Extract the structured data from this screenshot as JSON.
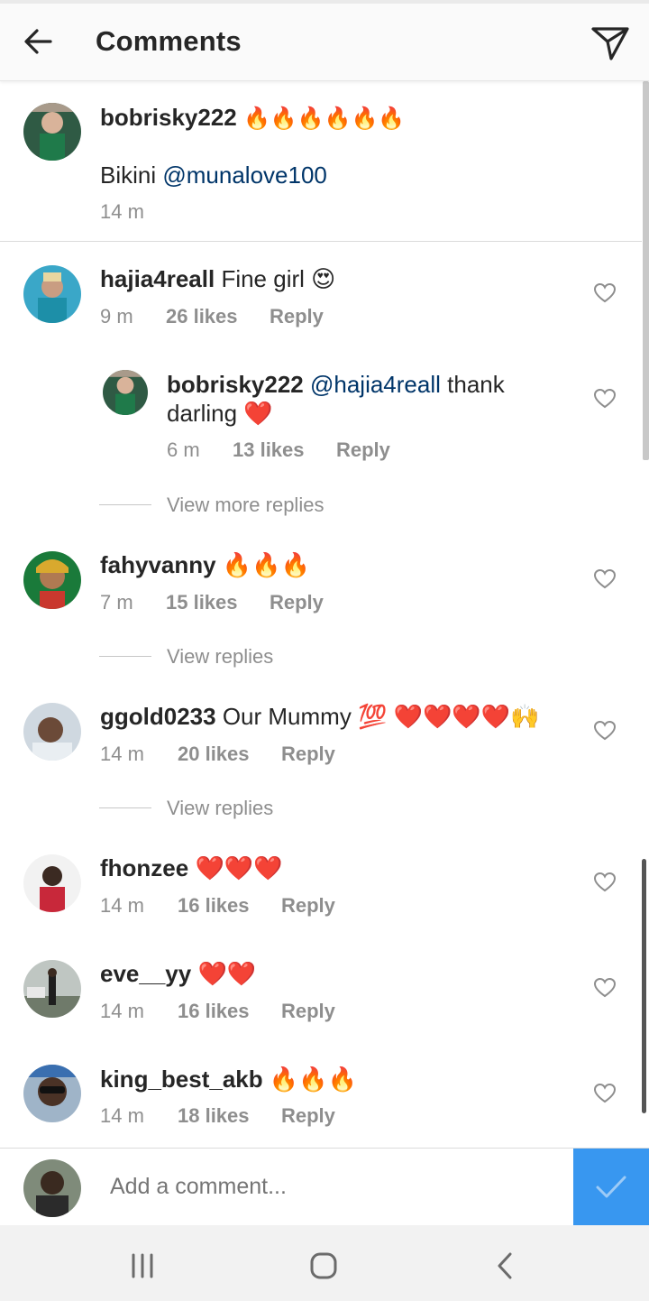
{
  "header": {
    "title": "Comments"
  },
  "caption": {
    "username": "bobrisky222",
    "emoji": "🔥🔥🔥🔥🔥🔥",
    "text": "Bikini",
    "mention": "@munalove100",
    "time": "14 m"
  },
  "comments": [
    {
      "username": "hajia4reall",
      "text": "Fine girl 😍",
      "time": "9 m",
      "likes": "26 likes",
      "reply": "Reply"
    },
    {
      "username": "fahyvanny",
      "text": "🔥🔥🔥",
      "time": "7 m",
      "likes": "15 likes",
      "reply": "Reply"
    },
    {
      "username": "ggold0233",
      "text": "Our Mummy 💯 ❤️❤️❤️❤️🙌",
      "time": "14 m",
      "likes": "20 likes",
      "reply": "Reply"
    },
    {
      "username": "fhonzee",
      "text": "❤️❤️❤️",
      "time": "14 m",
      "likes": "16 likes",
      "reply": "Reply"
    },
    {
      "username": "eve__yy",
      "text": "❤️❤️",
      "time": "14 m",
      "likes": "16 likes",
      "reply": "Reply"
    },
    {
      "username": "king_best_akb",
      "text": "🔥🔥🔥",
      "time": "14 m",
      "likes": "18 likes",
      "reply": "Reply"
    }
  ],
  "reply": {
    "username": "bobrisky222",
    "mention": "@hajia4reall",
    "text_line1": "thank",
    "text_line2": "darling ❤️",
    "time": "6 m",
    "likes": "13 likes",
    "reply": "Reply"
  },
  "view_more_replies": "View more replies",
  "view_replies": "View replies",
  "composer": {
    "placeholder": "Add a comment..."
  },
  "colors": {
    "accent": "#3897f0",
    "mention": "#003569",
    "meta": "#8e8e8e"
  }
}
